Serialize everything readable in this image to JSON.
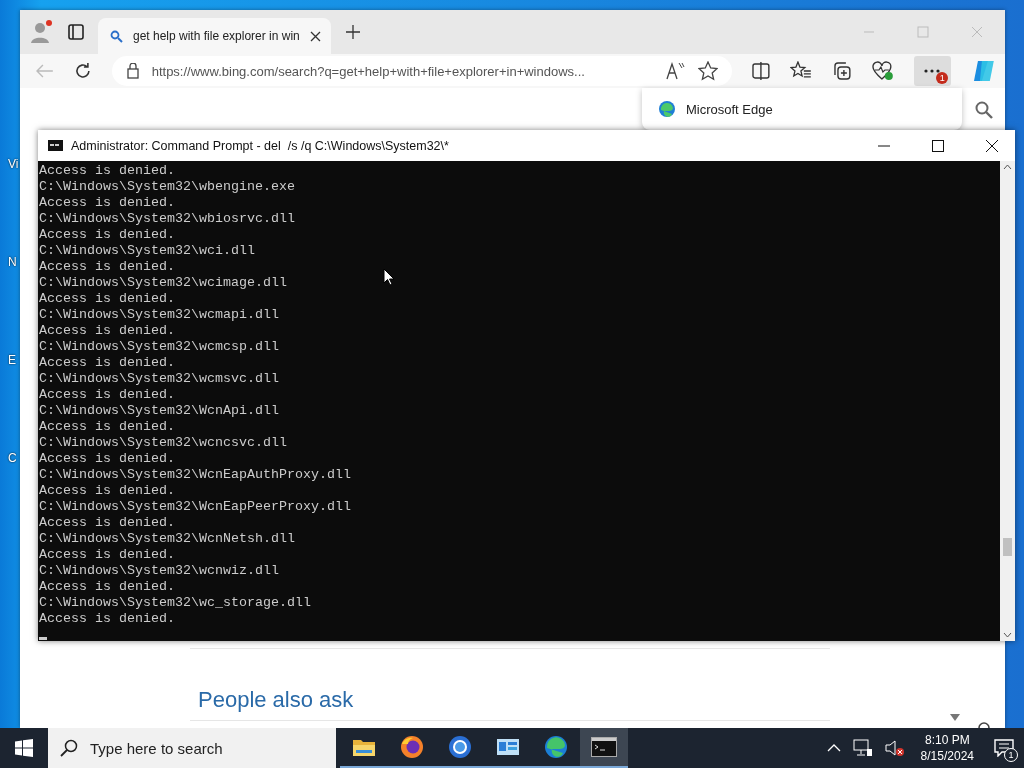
{
  "desktop": {
    "icon_labels": [
      "Vi",
      "N",
      "E",
      "C"
    ]
  },
  "browser": {
    "tabs": [
      {
        "title": "get help with file explorer in win",
        "selected": true
      }
    ],
    "address": "https://www.bing.com/search?q=get+help+with+file+explorer+in+windows...",
    "menu_badge": "1",
    "popup": {
      "title": "Microsoft Edge"
    },
    "page": {
      "heading": "People also ask"
    }
  },
  "console": {
    "title": "Administrator: Command Prompt - del  /s /q C:\\Windows\\System32\\*",
    "lines": [
      "Access is denied.",
      "C:\\Windows\\System32\\wbengine.exe",
      "Access is denied.",
      "C:\\Windows\\System32\\wbiosrvc.dll",
      "Access is denied.",
      "C:\\Windows\\System32\\wci.dll",
      "Access is denied.",
      "C:\\Windows\\System32\\wcimage.dll",
      "Access is denied.",
      "C:\\Windows\\System32\\wcmapi.dll",
      "Access is denied.",
      "C:\\Windows\\System32\\wcmcsp.dll",
      "Access is denied.",
      "C:\\Windows\\System32\\wcmsvc.dll",
      "Access is denied.",
      "C:\\Windows\\System32\\WcnApi.dll",
      "Access is denied.",
      "C:\\Windows\\System32\\wcncsvc.dll",
      "Access is denied.",
      "C:\\Windows\\System32\\WcnEapAuthProxy.dll",
      "Access is denied.",
      "C:\\Windows\\System32\\WcnEapPeerProxy.dll",
      "Access is denied.",
      "C:\\Windows\\System32\\WcnNetsh.dll",
      "Access is denied.",
      "C:\\Windows\\System32\\wcnwiz.dll",
      "Access is denied.",
      "C:\\Windows\\System32\\wc_storage.dll",
      "Access is denied."
    ]
  },
  "taskbar": {
    "search_placeholder": "Type here to search",
    "apps": [
      {
        "kind": "folder",
        "selected": false
      },
      {
        "kind": "firefox",
        "selected": false
      },
      {
        "kind": "chrome",
        "selected": false
      },
      {
        "kind": "control",
        "selected": false
      },
      {
        "kind": "edge",
        "selected": false
      },
      {
        "kind": "terminal",
        "selected": true
      }
    ],
    "time": "8:10 PM",
    "date": "8/15/2024",
    "notifications": "1"
  }
}
